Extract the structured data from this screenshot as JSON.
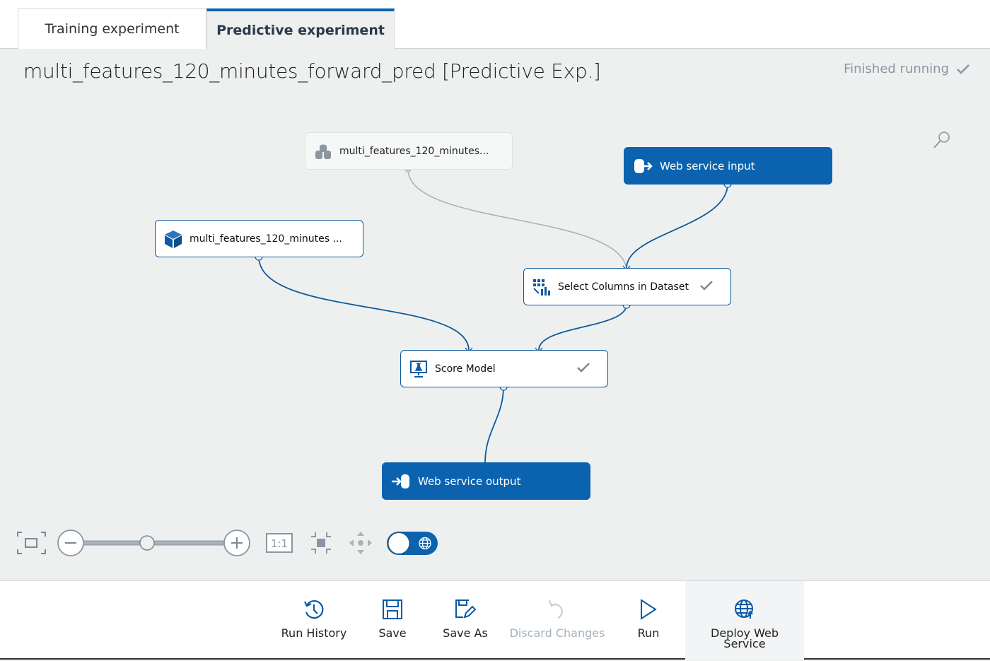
{
  "tabs": [
    {
      "label": "Training experiment",
      "active": false
    },
    {
      "label": "Predictive experiment",
      "active": true
    }
  ],
  "experiment": {
    "title": "multi_features_120_minutes_forward_pred [Predictive Exp.]",
    "status": "Finished running"
  },
  "nodes": {
    "dataset": {
      "label": "multi_features_120_minutes...",
      "icon": "database-icon"
    },
    "web_input": {
      "label": "Web service input",
      "icon": "web-input-icon"
    },
    "model": {
      "label": "multi_features_120_minutes ...",
      "icon": "cube-icon"
    },
    "select_columns": {
      "label": "Select Columns in Dataset",
      "icon": "select-columns-icon",
      "done": true
    },
    "score_model": {
      "label": "Score Model",
      "icon": "score-icon",
      "done": true
    },
    "web_output": {
      "label": "Web service output",
      "icon": "web-output-icon"
    }
  },
  "zoom_controls": {
    "one_to_one": "1:1",
    "zoom_level": 0.5
  },
  "toolbar": {
    "run_history": "Run History",
    "save": "Save",
    "save_as": "Save As",
    "discard": "Discard Changes",
    "run": "Run",
    "deploy": "Deploy Web Service"
  },
  "colors": {
    "accent": "#0b63b0",
    "canvas": "#eef0f0",
    "disabled": "#a6b0ba"
  }
}
